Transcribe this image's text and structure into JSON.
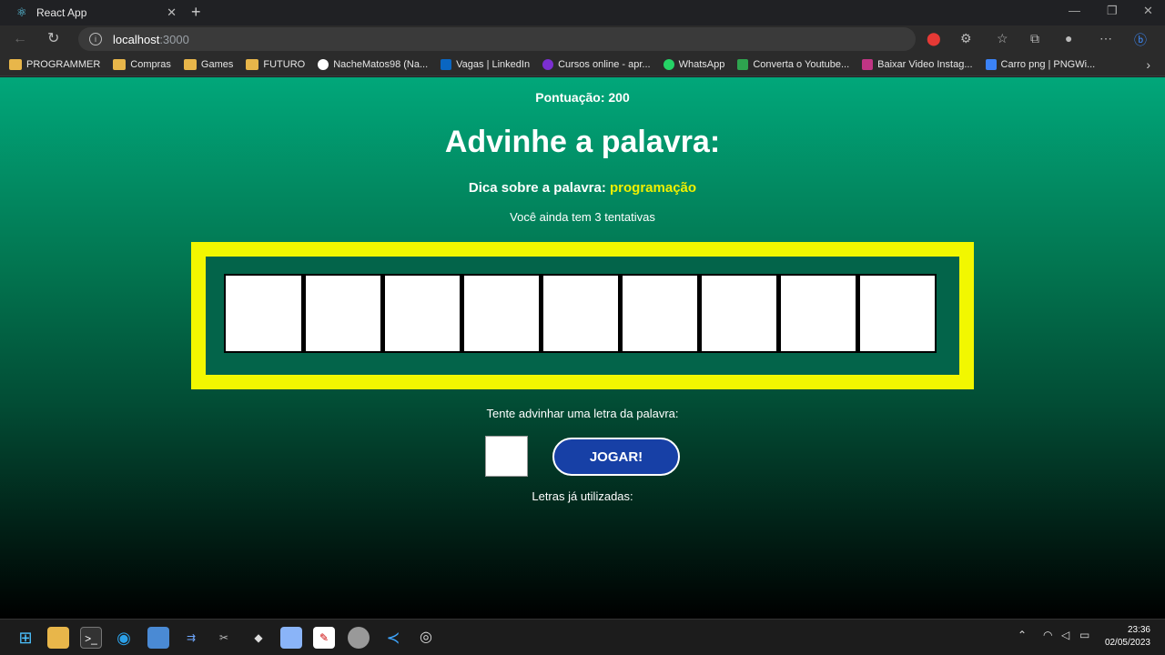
{
  "browser": {
    "tab_title": "React App",
    "url_host": "localhost",
    "url_port": ":3000",
    "bookmarks": [
      {
        "label": "PROGRAMMER",
        "color": "#e8b64a"
      },
      {
        "label": "Compras",
        "color": "#e8b64a"
      },
      {
        "label": "Games",
        "color": "#e8b64a"
      },
      {
        "label": "FUTURO",
        "color": "#e8b64a"
      },
      {
        "label": "NacheMatos98 (Na...",
        "color": "#ffffff"
      },
      {
        "label": "Vagas | LinkedIn",
        "color": "#0a66c2"
      },
      {
        "label": "Cursos online - apr...",
        "color": "#7b2fd1"
      },
      {
        "label": "WhatsApp",
        "color": "#25d366"
      },
      {
        "label": "Converta o Youtube...",
        "color": "#2ea44f"
      },
      {
        "label": "Baixar Video Instag...",
        "color": "#c13584"
      },
      {
        "label": "Carro png | PNGWi...",
        "color": "#3b82f6"
      }
    ]
  },
  "game": {
    "score": "Pontuação: 200",
    "heading": "Advinhe a palavra:",
    "hint_prefix": "Dica sobre a palavra:",
    "hint_word": "programação",
    "attempts": "Você ainda tem 3 tentativas",
    "letter_count": 9,
    "prompt": "Tente advinhar uma letra da palavra:",
    "play_button": "JOGAR!",
    "used_letters_label": "Letras já utilizadas:",
    "colors": {
      "board_frame": "#f2f700",
      "button": "#1740a6",
      "hint_word": "#f0f000"
    }
  },
  "taskbar": {
    "time": "23:36",
    "date": "02/05/2023"
  }
}
